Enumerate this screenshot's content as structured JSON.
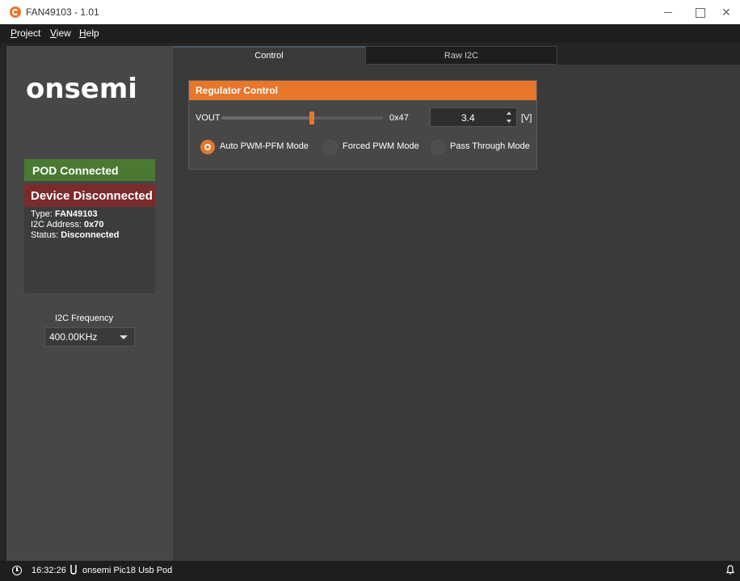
{
  "window": {
    "title": "FAN49103 - 1.01",
    "minimize_icon": "minimize-icon",
    "maximize_icon": "maximize-icon",
    "close_icon": "close-icon",
    "close_glyph": "✕"
  },
  "menu": {
    "items": [
      {
        "underline": "P",
        "rest": "roject"
      },
      {
        "underline": "V",
        "rest": "iew"
      },
      {
        "underline": "H",
        "rest": "elp"
      }
    ]
  },
  "sidebar": {
    "logo": "onsemi",
    "pod_status": "POD Connected",
    "device_status": "Device Disconnected",
    "device_type_label": "Type: ",
    "device_type_value": "FAN49103",
    "i2c_address_label": "I2C Address: ",
    "i2c_address_value": "0x70",
    "status_label": "Status: ",
    "status_value": "Disconnected",
    "i2c_frequency_label": "I2C Frequency",
    "i2c_frequency_value": "400.00KHz"
  },
  "tabs": [
    {
      "label": "Control",
      "active": true
    },
    {
      "label": "Raw I2C",
      "active": false
    }
  ],
  "regulator": {
    "title": "Regulator Control",
    "vout_label": "VOUT",
    "slider_fraction": 0.56,
    "hex_value": "0x47",
    "voltage_value": "3.4",
    "unit": "[V]",
    "modes": [
      {
        "label": "Auto PWM-PFM Mode",
        "selected": true
      },
      {
        "label": "Forced PWM Mode",
        "selected": false
      },
      {
        "label": "Pass Through Mode",
        "selected": false
      }
    ]
  },
  "statusbar": {
    "time": "16:32:26",
    "device": "onsemi Pic18 Usb Pod"
  },
  "colors": {
    "accent": "#e8762b",
    "pod_connected": "#4a7a31",
    "device_disconnected": "#7a2b2b"
  }
}
